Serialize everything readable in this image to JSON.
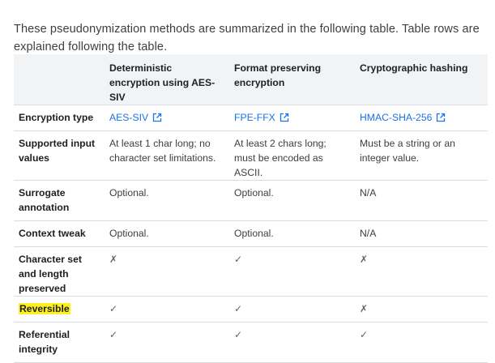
{
  "intro": "These pseudonymization methods are summarized in the following table. Table rows are explained following the table.",
  "table": {
    "headers": [
      "",
      "Deterministic encryption using AES-SIV",
      "Format preserving encryption",
      "Cryptographic hashing"
    ],
    "rows": [
      {
        "label": "Encryption type",
        "cells": [
          "AES-SIV",
          "FPE-FFX",
          "HMAC-SHA-256"
        ]
      },
      {
        "label": "Supported input values",
        "cells": [
          "At least 1 char long; no character set limitations.",
          "At least 2 chars long; must be encoded as ASCII.",
          "Must be a string or an integer value."
        ]
      },
      {
        "label": "Surrogate annotation",
        "cells": [
          "Optional.",
          "Optional.",
          "N/A"
        ]
      },
      {
        "label": "Context tweak",
        "cells": [
          "Optional.",
          "Optional.",
          "N/A"
        ]
      },
      {
        "label": "Character set and length preserved",
        "cells": [
          "✗",
          "✓",
          "✗"
        ]
      },
      {
        "label": "Reversible",
        "cells": [
          "✓",
          "✓",
          "✗"
        ]
      },
      {
        "label": "Referential integrity",
        "cells": [
          "✓",
          "✓",
          "✓"
        ]
      }
    ]
  },
  "colors": {
    "link": "#1a73e8",
    "header_bg": "#f1f3f4",
    "highlight": "#fff11f",
    "border": "#dadce0"
  },
  "icons": {
    "external_link": "external-link-icon",
    "check": "check-icon",
    "cross": "cross-icon"
  }
}
